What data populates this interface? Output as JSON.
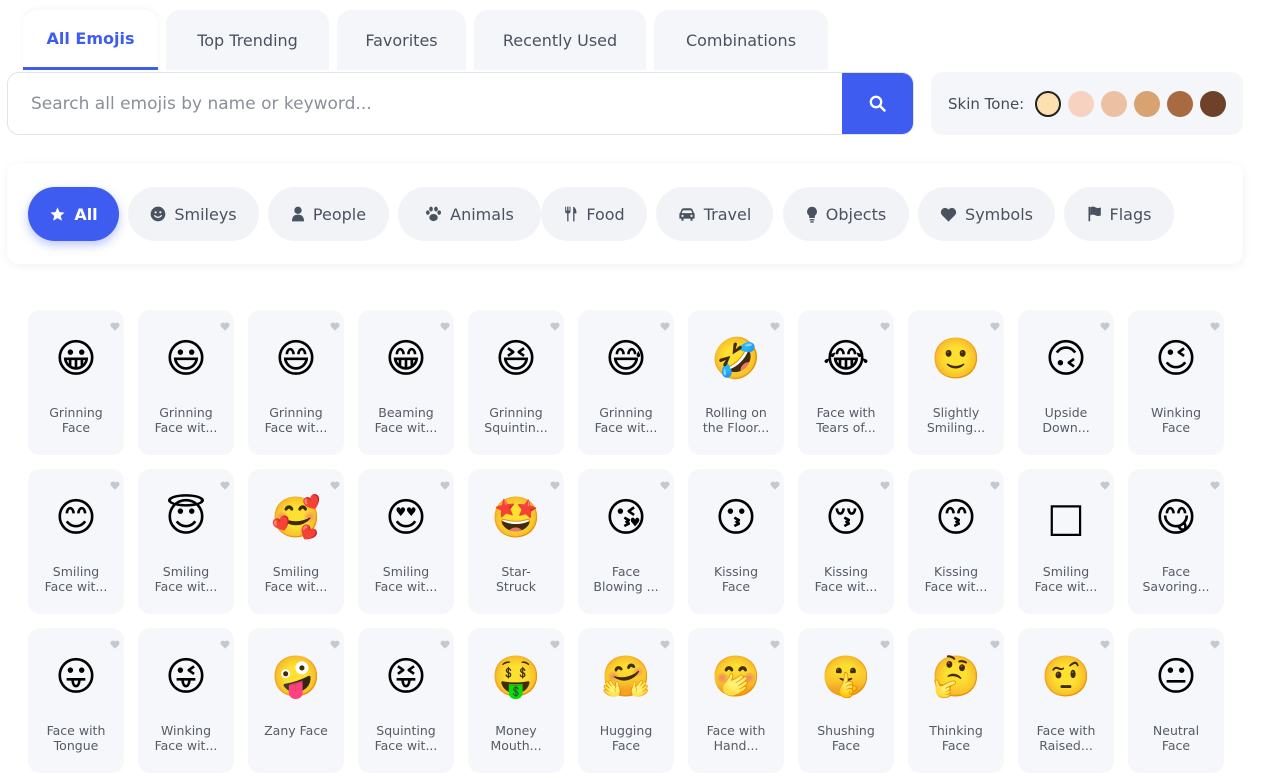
{
  "tabs": [
    "All Emojis",
    "Top Trending",
    "Favorites",
    "Recently Used",
    "Combinations"
  ],
  "search": {
    "placeholder": "Search all emojis by name or keyword..."
  },
  "skin_tone": {
    "label": "Skin Tone:",
    "tones": [
      "#fde0b0",
      "#f6d3c0",
      "#ecc1a3",
      "#d8a271",
      "#a86a41",
      "#6e4228"
    ]
  },
  "categories": [
    {
      "label": "All",
      "icon": "star-icon"
    },
    {
      "label": "Smileys",
      "icon": "smile-icon"
    },
    {
      "label": "People",
      "icon": "person-icon"
    },
    {
      "label": "Animals",
      "icon": "paw-icon"
    },
    {
      "label": "Food",
      "icon": "utensils-icon"
    },
    {
      "label": "Travel",
      "icon": "car-icon"
    },
    {
      "label": "Objects",
      "icon": "lightbulb-icon"
    },
    {
      "label": "Symbols",
      "icon": "heart-icon"
    },
    {
      "label": "Flags",
      "icon": "flag-icon"
    }
  ],
  "emojis": [
    {
      "char": "😀",
      "name": [
        "Grinning",
        "Face"
      ]
    },
    {
      "char": "😃",
      "name": [
        "Grinning",
        "Face wit..."
      ]
    },
    {
      "char": "😄",
      "name": [
        "Grinning",
        "Face wit..."
      ]
    },
    {
      "char": "😁",
      "name": [
        "Beaming",
        "Face wit..."
      ]
    },
    {
      "char": "😆",
      "name": [
        "Grinning",
        "Squintin..."
      ]
    },
    {
      "char": "😅",
      "name": [
        "Grinning",
        "Face wit..."
      ]
    },
    {
      "char": "🤣",
      "name": [
        "Rolling on",
        "the Floor..."
      ]
    },
    {
      "char": "😂",
      "name": [
        "Face with",
        "Tears of..."
      ]
    },
    {
      "char": "🙂",
      "name": [
        "Slightly",
        "Smiling..."
      ]
    },
    {
      "char": "🙃",
      "name": [
        "Upside",
        "Down..."
      ]
    },
    {
      "char": "😉",
      "name": [
        "Winking",
        "Face"
      ]
    },
    {
      "char": "😊",
      "name": [
        "Smiling",
        "Face wit..."
      ]
    },
    {
      "char": "😇",
      "name": [
        "Smiling",
        "Face wit..."
      ]
    },
    {
      "char": "🥰",
      "name": [
        "Smiling",
        "Face wit..."
      ]
    },
    {
      "char": "😍",
      "name": [
        "Smiling",
        "Face wit..."
      ]
    },
    {
      "char": "🤩",
      "name": [
        "Star-",
        "Struck"
      ]
    },
    {
      "char": "😘",
      "name": [
        "Face",
        "Blowing ..."
      ]
    },
    {
      "char": "😗",
      "name": [
        "Kissing",
        "Face"
      ]
    },
    {
      "char": "😚",
      "name": [
        "Kissing",
        "Face wit..."
      ]
    },
    {
      "char": "😙",
      "name": [
        "Kissing",
        "Face wit..."
      ]
    },
    {
      "char": "□",
      "name": [
        "Smiling",
        "Face wit..."
      ]
    },
    {
      "char": "😋",
      "name": [
        "Face",
        "Savoring..."
      ]
    },
    {
      "char": "😛",
      "name": [
        "Face with",
        "Tongue"
      ]
    },
    {
      "char": "😜",
      "name": [
        "Winking",
        "Face wit..."
      ]
    },
    {
      "char": "🤪",
      "name": [
        "Zany Face"
      ]
    },
    {
      "char": "😝",
      "name": [
        "Squinting",
        "Face wit..."
      ]
    },
    {
      "char": "🤑",
      "name": [
        "Money",
        "Mouth..."
      ]
    },
    {
      "char": "🤗",
      "name": [
        "Hugging",
        "Face"
      ]
    },
    {
      "char": "🤭",
      "name": [
        "Face with",
        "Hand..."
      ]
    },
    {
      "char": "🤫",
      "name": [
        "Shushing",
        "Face"
      ]
    },
    {
      "char": "🤔",
      "name": [
        "Thinking",
        "Face"
      ]
    },
    {
      "char": "🤨",
      "name": [
        "Face with",
        "Raised..."
      ]
    },
    {
      "char": "😐",
      "name": [
        "Neutral",
        "Face"
      ]
    }
  ],
  "colors": {
    "accent": "#3f5cf0",
    "card_bg": "#f6f7fa",
    "chip_bg": "#f1f3f7"
  }
}
